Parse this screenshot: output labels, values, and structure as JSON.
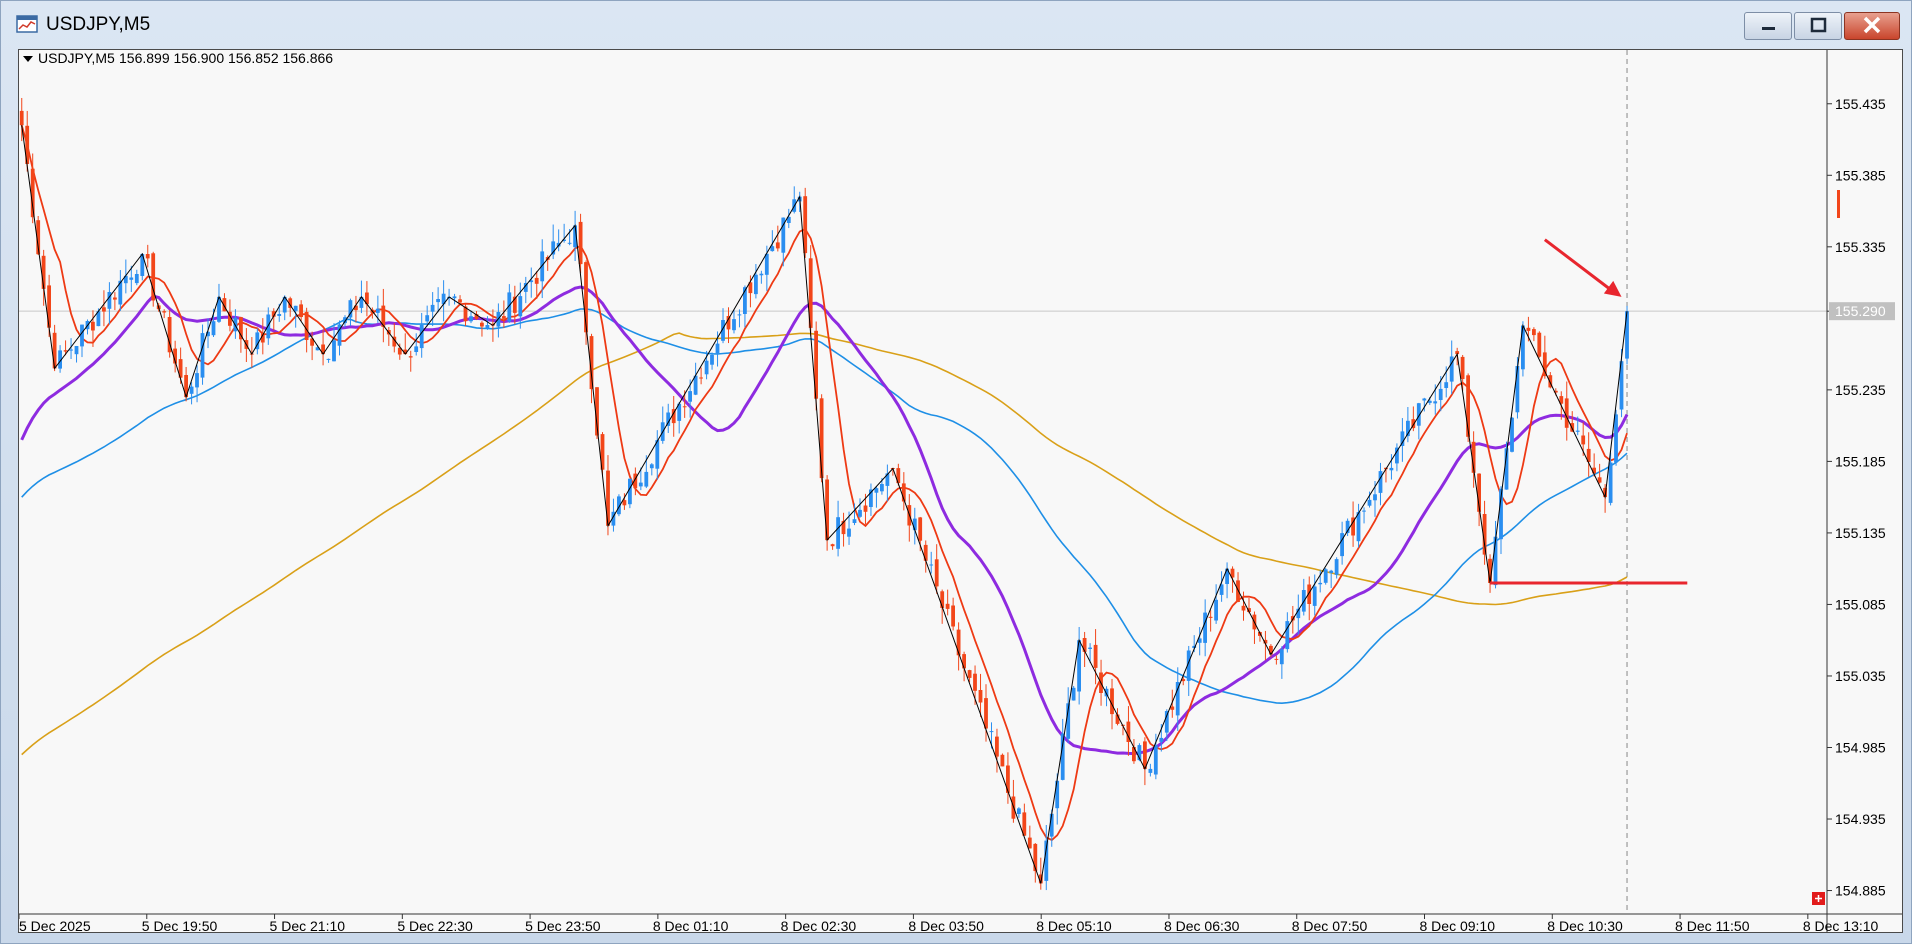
{
  "window": {
    "title": "USDJPY,M5",
    "buttons": [
      "minimize",
      "maximize",
      "close"
    ]
  },
  "chart_header": {
    "symbol": "USDJPY,M5",
    "ohlc": "156.899 156.900 156.852 156.866"
  },
  "colors": {
    "bull": "#2a8ef0",
    "bear": "#f2461a",
    "ma_fast": "#ee3a14",
    "ma_mid": "#8e2be0",
    "ma_slow": "#1e8fe6",
    "ma_slowest": "#d9a018",
    "zigzag": "#000000",
    "annotation": "#e8262e",
    "background": "#f8f8f8"
  },
  "chart_data": {
    "type": "candlestick",
    "symbol": "USDJPY",
    "timeframe": "M5",
    "y_ticks": [
      "155.435",
      "155.385",
      "155.335",
      "155.290",
      "155.235",
      "155.185",
      "155.135",
      "155.085",
      "155.035",
      "154.985",
      "154.935",
      "154.885"
    ],
    "ylim": [
      154.87,
      155.46
    ],
    "current_price": "155.290",
    "x_ticks": [
      "5 Dec 2025",
      "5 Dec 19:50",
      "5 Dec 21:10",
      "5 Dec 22:30",
      "5 Dec 23:50",
      "8 Dec 01:10",
      "8 Dec 02:30",
      "8 Dec 03:50",
      "8 Dec 05:10",
      "8 Dec 06:30",
      "8 Dec 07:50",
      "8 Dec 09:10",
      "8 Dec 10:30",
      "8 Dec 11:50",
      "8 Dec 13:10"
    ],
    "zigzag_points": [
      [
        0,
        155.42
      ],
      [
        6,
        155.25
      ],
      [
        22,
        155.33
      ],
      [
        30,
        155.23
      ],
      [
        36,
        155.3
      ],
      [
        42,
        155.26
      ],
      [
        48,
        155.3
      ],
      [
        55,
        155.26
      ],
      [
        62,
        155.3
      ],
      [
        70,
        155.26
      ],
      [
        78,
        155.3
      ],
      [
        86,
        155.28
      ],
      [
        101,
        155.35
      ],
      [
        107,
        155.14
      ],
      [
        142,
        155.37
      ],
      [
        147,
        155.13
      ],
      [
        159,
        155.18
      ],
      [
        186,
        154.89
      ],
      [
        193,
        155.06
      ],
      [
        205,
        154.97
      ],
      [
        220,
        155.11
      ],
      [
        228,
        155.05
      ],
      [
        262,
        155.26
      ],
      [
        268,
        155.1
      ],
      [
        274,
        155.28
      ],
      [
        289,
        155.16
      ],
      [
        293,
        155.29
      ]
    ],
    "support_line": {
      "price": 155.1,
      "from_index": 268,
      "to_index": 304
    },
    "arrow_annotation": {
      "from": [
        278,
        155.34
      ],
      "to": [
        292,
        155.3
      ]
    }
  }
}
